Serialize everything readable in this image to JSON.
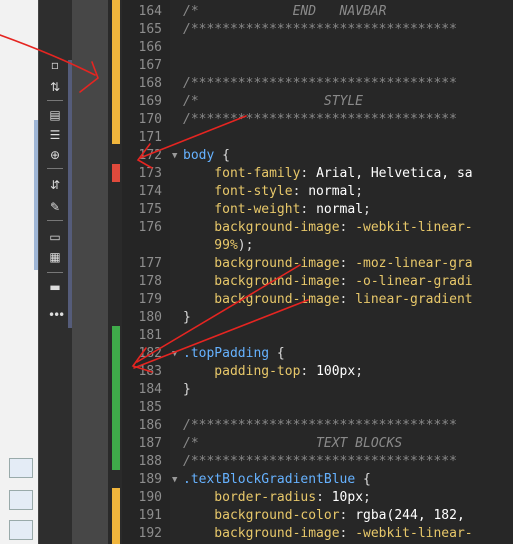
{
  "colors": {
    "marker_yellow": "#f0b53c",
    "marker_red": "#e04a3c",
    "marker_green": "#3fab4a",
    "annotation_red": "#e52521"
  },
  "toolbar": {
    "icons": [
      "new-file-icon",
      "sort-icon",
      "code-view-icon",
      "format-icon",
      "target-icon",
      "expand-icon",
      "brush-icon",
      "comment-icon",
      "snippet-icon",
      "code-hint-icon"
    ],
    "more_label": "•••"
  },
  "editor": {
    "lines": [
      {
        "n": "164",
        "parts": [
          {
            "t": "/*            END   NAVBAR",
            "c": "cmt"
          }
        ]
      },
      {
        "n": "165",
        "parts": [
          {
            "t": "/**********************************",
            "c": "cmt"
          }
        ]
      },
      {
        "n": "166",
        "parts": []
      },
      {
        "n": "167",
        "parts": []
      },
      {
        "n": "168",
        "parts": [
          {
            "t": "/**********************************",
            "c": "cmt"
          }
        ]
      },
      {
        "n": "169",
        "parts": [
          {
            "t": "/*                STYLE",
            "c": "cmt"
          }
        ]
      },
      {
        "n": "170",
        "parts": [
          {
            "t": "/**********************************",
            "c": "cmt"
          }
        ]
      },
      {
        "n": "171",
        "parts": []
      },
      {
        "n": "172",
        "fold": true,
        "parts": [
          {
            "t": "body",
            "c": "sel"
          },
          {
            "t": " {",
            "c": "punc"
          }
        ]
      },
      {
        "n": "173",
        "parts": [
          {
            "t": "    font-family",
            "c": "prop"
          },
          {
            "t": ": ",
            "c": "punc"
          },
          {
            "t": "Arial, Helvetica, sa",
            "c": "val"
          }
        ]
      },
      {
        "n": "174",
        "parts": [
          {
            "t": "    font-style",
            "c": "prop"
          },
          {
            "t": ": ",
            "c": "punc"
          },
          {
            "t": "normal",
            "c": "val"
          },
          {
            "t": ";",
            "c": "punc"
          }
        ]
      },
      {
        "n": "175",
        "parts": [
          {
            "t": "    font-weight",
            "c": "prop"
          },
          {
            "t": ": ",
            "c": "punc"
          },
          {
            "t": "normal",
            "c": "val"
          },
          {
            "t": ";",
            "c": "punc"
          }
        ]
      },
      {
        "n": "176",
        "parts": [
          {
            "t": "    background-image",
            "c": "prop"
          },
          {
            "t": ": ",
            "c": "punc"
          },
          {
            "t": "-webkit-linear-",
            "c": "prop"
          }
        ]
      },
      {
        "n": "",
        "parts": [
          {
            "t": "    99%",
            "c": "prop"
          },
          {
            "t": ");",
            "c": "punc"
          }
        ]
      },
      {
        "n": "177",
        "parts": [
          {
            "t": "    background-image",
            "c": "prop"
          },
          {
            "t": ": ",
            "c": "punc"
          },
          {
            "t": "-moz-linear-gra",
            "c": "prop"
          }
        ]
      },
      {
        "n": "178",
        "parts": [
          {
            "t": "    background-image",
            "c": "prop"
          },
          {
            "t": ": ",
            "c": "punc"
          },
          {
            "t": "-o-linear-gradi",
            "c": "prop"
          }
        ]
      },
      {
        "n": "179",
        "parts": [
          {
            "t": "    background-image",
            "c": "prop"
          },
          {
            "t": ": ",
            "c": "punc"
          },
          {
            "t": "linear-gradient",
            "c": "prop"
          }
        ]
      },
      {
        "n": "180",
        "parts": [
          {
            "t": "}",
            "c": "punc"
          }
        ]
      },
      {
        "n": "181",
        "parts": []
      },
      {
        "n": "182",
        "fold": true,
        "parts": [
          {
            "t": ".topPadding",
            "c": "sel"
          },
          {
            "t": " {",
            "c": "punc"
          }
        ]
      },
      {
        "n": "183",
        "parts": [
          {
            "t": "    padding-top",
            "c": "prop"
          },
          {
            "t": ": ",
            "c": "punc"
          },
          {
            "t": "100px",
            "c": "val"
          },
          {
            "t": ";",
            "c": "punc"
          }
        ]
      },
      {
        "n": "184",
        "parts": [
          {
            "t": "}",
            "c": "punc"
          }
        ]
      },
      {
        "n": "185",
        "parts": []
      },
      {
        "n": "186",
        "parts": [
          {
            "t": "/**********************************",
            "c": "cmt"
          }
        ]
      },
      {
        "n": "187",
        "parts": [
          {
            "t": "/*               TEXT BLOCKS",
            "c": "cmt"
          }
        ]
      },
      {
        "n": "188",
        "parts": [
          {
            "t": "/**********************************",
            "c": "cmt"
          }
        ]
      },
      {
        "n": "189",
        "fold": true,
        "parts": [
          {
            "t": ".textBlockGradientBlue",
            "c": "sel"
          },
          {
            "t": " {",
            "c": "punc"
          }
        ]
      },
      {
        "n": "190",
        "parts": [
          {
            "t": "    border-radius",
            "c": "prop"
          },
          {
            "t": ": ",
            "c": "punc"
          },
          {
            "t": "10px",
            "c": "val"
          },
          {
            "t": ";",
            "c": "punc"
          }
        ]
      },
      {
        "n": "191",
        "parts": [
          {
            "t": "    background-color",
            "c": "prop"
          },
          {
            "t": ": ",
            "c": "punc"
          },
          {
            "t": "rgba(244, 182,",
            "c": "val"
          }
        ]
      },
      {
        "n": "192",
        "parts": [
          {
            "t": "    background-image",
            "c": "prop"
          },
          {
            "t": ": ",
            "c": "punc"
          },
          {
            "t": "-webkit-linear-",
            "c": "prop"
          }
        ]
      }
    ]
  }
}
